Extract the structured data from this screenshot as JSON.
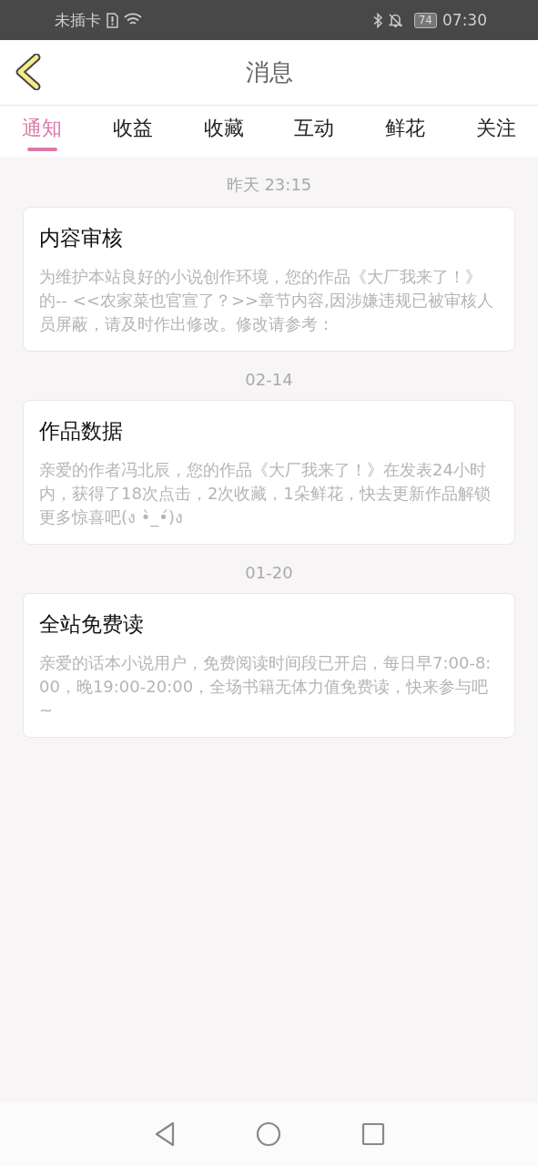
{
  "status_bar": {
    "carrier": "未插卡",
    "battery": "74",
    "time": "07:30"
  },
  "header": {
    "title": "消息"
  },
  "tabs": [
    {
      "label": "通知",
      "selected": true
    },
    {
      "label": "收益",
      "selected": false
    },
    {
      "label": "收藏",
      "selected": false
    },
    {
      "label": "互动",
      "selected": false
    },
    {
      "label": "鲜花",
      "selected": false
    },
    {
      "label": "关注",
      "selected": false
    }
  ],
  "messages": [
    {
      "time": "昨天 23:15",
      "title": "内容审核",
      "body": "为维护本站良好的小说创作环境，您的作品《大厂我来了！》的-- <<农家菜也官宣了？>>章节内容,因涉嫌违规已被审核人员屏蔽，请及时作出修改。修改请参考："
    },
    {
      "time": "02-14",
      "title": "作品数据",
      "body": "亲爱的作者冯北辰，您的作品《大厂我来了！》在发表24小时内，获得了18次点击，2次收藏，1朵鲜花，快去更新作品解锁更多惊喜吧(ง •̀_•́)ง"
    },
    {
      "time": "01-20",
      "title": "全站免费读",
      "body": "亲爱的话本小说用户，免费阅读时间段已开启，每日早7:00-8:00，晚19:00-20:00，全场书籍无体力值免费读，快来参与吧 ~"
    }
  ]
}
